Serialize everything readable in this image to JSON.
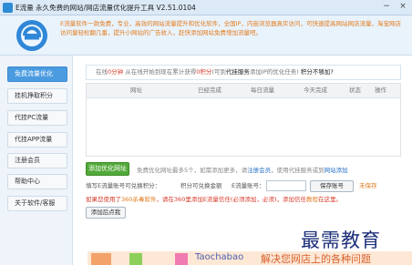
{
  "window": {
    "title": "E流量 永久免费的网站/网店流量优化提升工具 V2.51.0104",
    "min_glyph": "−",
    "close_glyph": "×"
  },
  "header": {
    "logo_icon": "e-logo-icon",
    "intro_text": "E流量软件一款免费，专业，高效的网站流量提升和优化软件，全国IP，内嵌浏览器真实访问，可快速提高网站网店流量，淘宝网店访问量轻松翻几番，提升小网站的广告收入，赶快添加网站免费增加流量吧。"
  },
  "sidebar": {
    "items": [
      {
        "label": "免费流量优化",
        "active": true
      },
      {
        "label": "挂机挣取积分",
        "active": false
      },
      {
        "label": "代挂PC流量",
        "active": false
      },
      {
        "label": "代挂APP流量",
        "active": false
      },
      {
        "label": "注册会员",
        "active": false
      },
      {
        "label": "帮助中心",
        "active": false
      },
      {
        "label": "关于软件/客服",
        "active": false
      }
    ]
  },
  "status": {
    "prefix": "在线",
    "online_time": "0分钟",
    "mid": "从在线开始到现在累计获得",
    "points": "0积分",
    "tail": "(可到",
    "service": "代挂服务",
    "tail2": "添加IP的优化任务)",
    "question": "积分不够加?"
  },
  "table": {
    "columns": [
      "网址",
      "已经完成",
      "每日流量",
      "今天完成",
      "状态",
      "操作"
    ]
  },
  "add_section": {
    "button": "添加优化网址",
    "note_prefix": "免费优化网址最多5个，如需添加更多，请",
    "register": "注册会员",
    "note_suffix": "，使用代挂服务或到",
    "sync": "网站添加"
  },
  "login": {
    "label": "填写E流量账号可兑换积分：",
    "exchange": "积分可兑换金额",
    "account_label": "E流量账号：",
    "save_button": "保存账号",
    "unsaved": "未保存"
  },
  "warning": {
    "part1": "如果您使用了",
    "n1": "360杀毒软件",
    "part2": "，请在",
    "n2": "360里添加E流量信任(必须添加",
    "part3": "，必须)，添加信任",
    "n3": "教程",
    "part4": "在这里。"
  },
  "quickstart": {
    "button": "添加后点我"
  },
  "watermark": {
    "text": "最需教育"
  },
  "banner": {
    "brand": "Taochabao",
    "slogan": "解决您网店上的各种问题"
  }
}
